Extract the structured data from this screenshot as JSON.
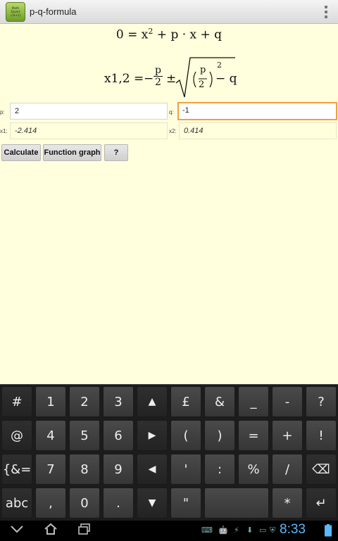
{
  "app": {
    "title": "p-q-formula",
    "icon_text": [
      "Math",
      "Expert",
      "√(x+1)"
    ]
  },
  "formulas": {
    "equation_lhs": "0 = x",
    "equation_rest": " + p · x + q",
    "solution_lhs": "x1,2 =",
    "minus": "−",
    "pm": "±",
    "frac_num": "p",
    "frac_den": "2",
    "minus_q": "− q",
    "superscript": "2"
  },
  "fields": {
    "p_label": "p:",
    "p_value": "2",
    "q_label": "q:",
    "q_value": "-1",
    "x1_label": "x1:",
    "x1_value": "-2.414",
    "x2_label": "x2:",
    "x2_value": "0.414"
  },
  "buttons": {
    "calculate": "Calculate",
    "function_graph": "Function graph",
    "help": "?"
  },
  "keyboard": {
    "row1": [
      "#",
      "1",
      "2",
      "3",
      "▲",
      "£",
      "&",
      "_",
      "-",
      "?"
    ],
    "row2": [
      "@",
      "4",
      "5",
      "6",
      "▶",
      "(",
      ")",
      "=",
      "+",
      "!"
    ],
    "row3": [
      "{&=",
      "7",
      "8",
      "9",
      "◀",
      "'",
      ":",
      "%",
      "/",
      "⌫"
    ],
    "row4": [
      "abc",
      ",",
      "0",
      ".",
      "▼",
      "\"",
      "*",
      "↵"
    ]
  },
  "statusbar": {
    "time": "8:33"
  },
  "colors": {
    "content_bg": "#ffffdd",
    "focus_border": "#f0a040",
    "clock": "#5ab8ff"
  }
}
